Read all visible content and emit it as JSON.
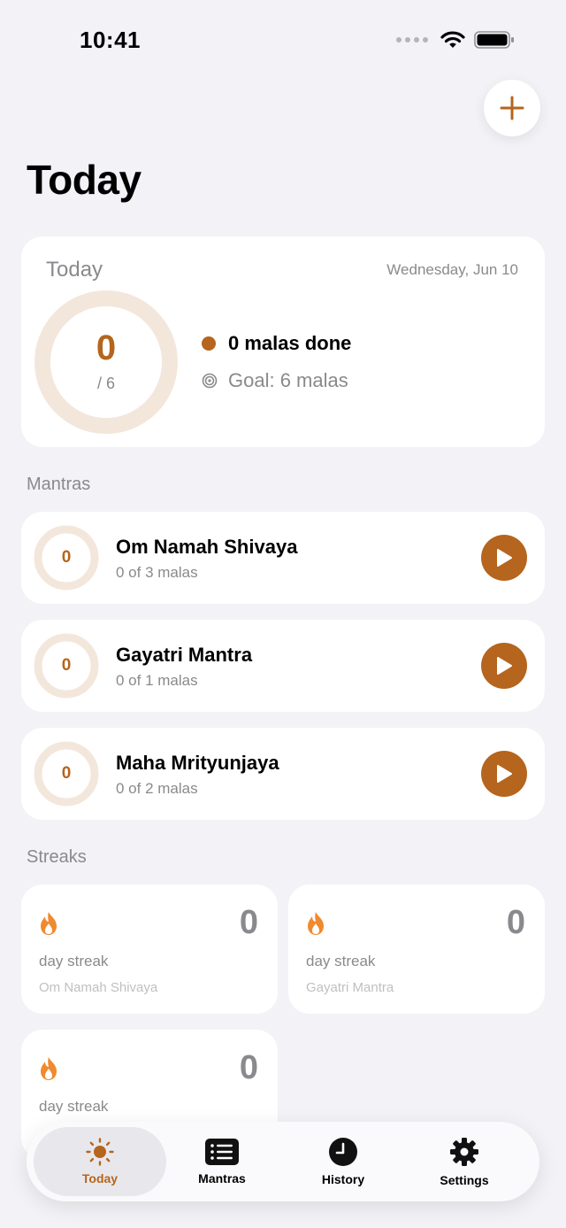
{
  "status_bar": {
    "time": "10:41"
  },
  "header": {
    "title": "Today"
  },
  "summary": {
    "label": "Today",
    "date": "Wednesday, Jun 10",
    "count": "0",
    "goal_fraction": "/ 6",
    "done_text": "0 malas done",
    "goal_text": "Goal: 6 malas",
    "progress": 0
  },
  "sections": {
    "mantras": "Mantras",
    "streaks": "Streaks"
  },
  "mantras": [
    {
      "count": "0",
      "name": "Om Namah Shivaya",
      "progress": "0 of 3 malas"
    },
    {
      "count": "0",
      "name": "Gayatri Mantra",
      "progress": "0 of 1 malas"
    },
    {
      "count": "0",
      "name": "Maha Mrityunjaya",
      "progress": "0 of 2 malas"
    }
  ],
  "streaks": [
    {
      "count": "0",
      "label": "day streak",
      "mantra": "Om Namah Shivaya"
    },
    {
      "count": "0",
      "label": "day streak",
      "mantra": "Gayatri Mantra"
    },
    {
      "count": "0",
      "label": "day streak",
      "mantra": ""
    }
  ],
  "tabs": [
    {
      "label": "Today",
      "icon": "sun-icon",
      "active": true
    },
    {
      "label": "Mantras",
      "icon": "list-icon",
      "active": false
    },
    {
      "label": "History",
      "icon": "clock-icon",
      "active": false
    },
    {
      "label": "Settings",
      "icon": "gear-icon",
      "active": false
    }
  ],
  "colors": {
    "accent": "#B5651D",
    "ring_track": "#F3E7DC",
    "flame": "#F08A2E",
    "background": "#F2F2F7"
  }
}
